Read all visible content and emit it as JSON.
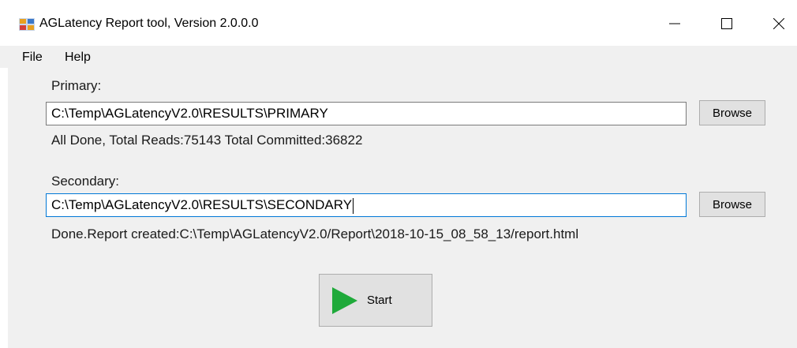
{
  "window": {
    "title": "AGLatency Report tool, Version 2.0.0.0",
    "controls": [
      "minimize-icon",
      "maximize-icon",
      "close-icon"
    ]
  },
  "menu": {
    "items": [
      "File",
      "Help"
    ]
  },
  "primary": {
    "label": "Primary:",
    "path": "C:\\Temp\\AGLatencyV2.0\\RESULTS\\PRIMARY",
    "browse_label": "Browse",
    "status": "All Done, Total Reads:75143 Total Committed:36822"
  },
  "secondary": {
    "label": "Secondary:",
    "path": "C:\\Temp\\AGLatencyV2.0\\RESULTS\\SECONDARY",
    "browse_label": "Browse",
    "status": "Done.Report created:C:\\Temp\\AGLatencyV2.0/Report\\2018-10-15_08_58_13/report.html"
  },
  "start": {
    "label": "Start",
    "icon": "play-icon",
    "icon_color": "#1faa3a"
  },
  "colors": {
    "accent_focus": "#0078d7",
    "form_background": "#f0f0f0",
    "button_face": "#e1e1e1"
  }
}
